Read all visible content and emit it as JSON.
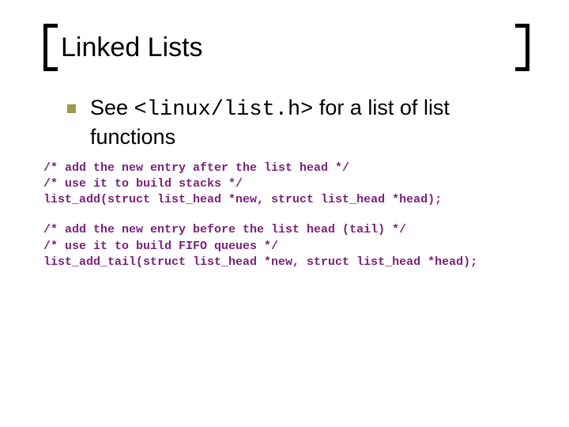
{
  "title": "Linked Lists",
  "bullet": {
    "pre": "See ",
    "code": "<linux/list.h>",
    "post": " for a list of list functions"
  },
  "code1": "/* add the new entry after the list head */\n/* use it to build stacks */\nlist_add(struct list_head *new, struct list_head *head);",
  "code2": "/* add the new entry before the list head (tail) */\n/* use it to build FIFO queues */\nlist_add_tail(struct list_head *new, struct list_head *head);"
}
